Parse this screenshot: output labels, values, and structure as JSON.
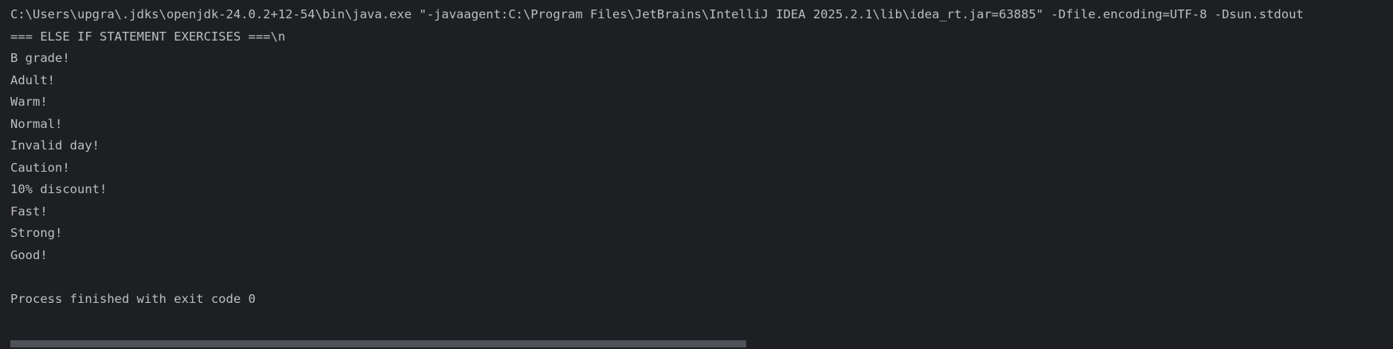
{
  "console": {
    "command_line": "C:\\Users\\upgra\\.jdks\\openjdk-24.0.2+12-54\\bin\\java.exe \"-javaagent:C:\\Program Files\\JetBrains\\IntelliJ IDEA 2025.2.1\\lib\\idea_rt.jar=63885\" -Dfile.encoding=UTF-8 -Dsun.stdout",
    "output": [
      "=== ELSE IF STATEMENT EXERCISES ===\\n",
      "B grade!",
      "Adult!",
      "Warm!",
      "Normal!",
      "Invalid day!",
      "Caution!",
      "10% discount!",
      "Fast!",
      "Strong!",
      "Good!"
    ],
    "exit_message": "Process finished with exit code 0"
  },
  "colors": {
    "background": "#1e1f22",
    "text": "#bcbec4",
    "scrollbar_thumb": "#4e5157"
  }
}
